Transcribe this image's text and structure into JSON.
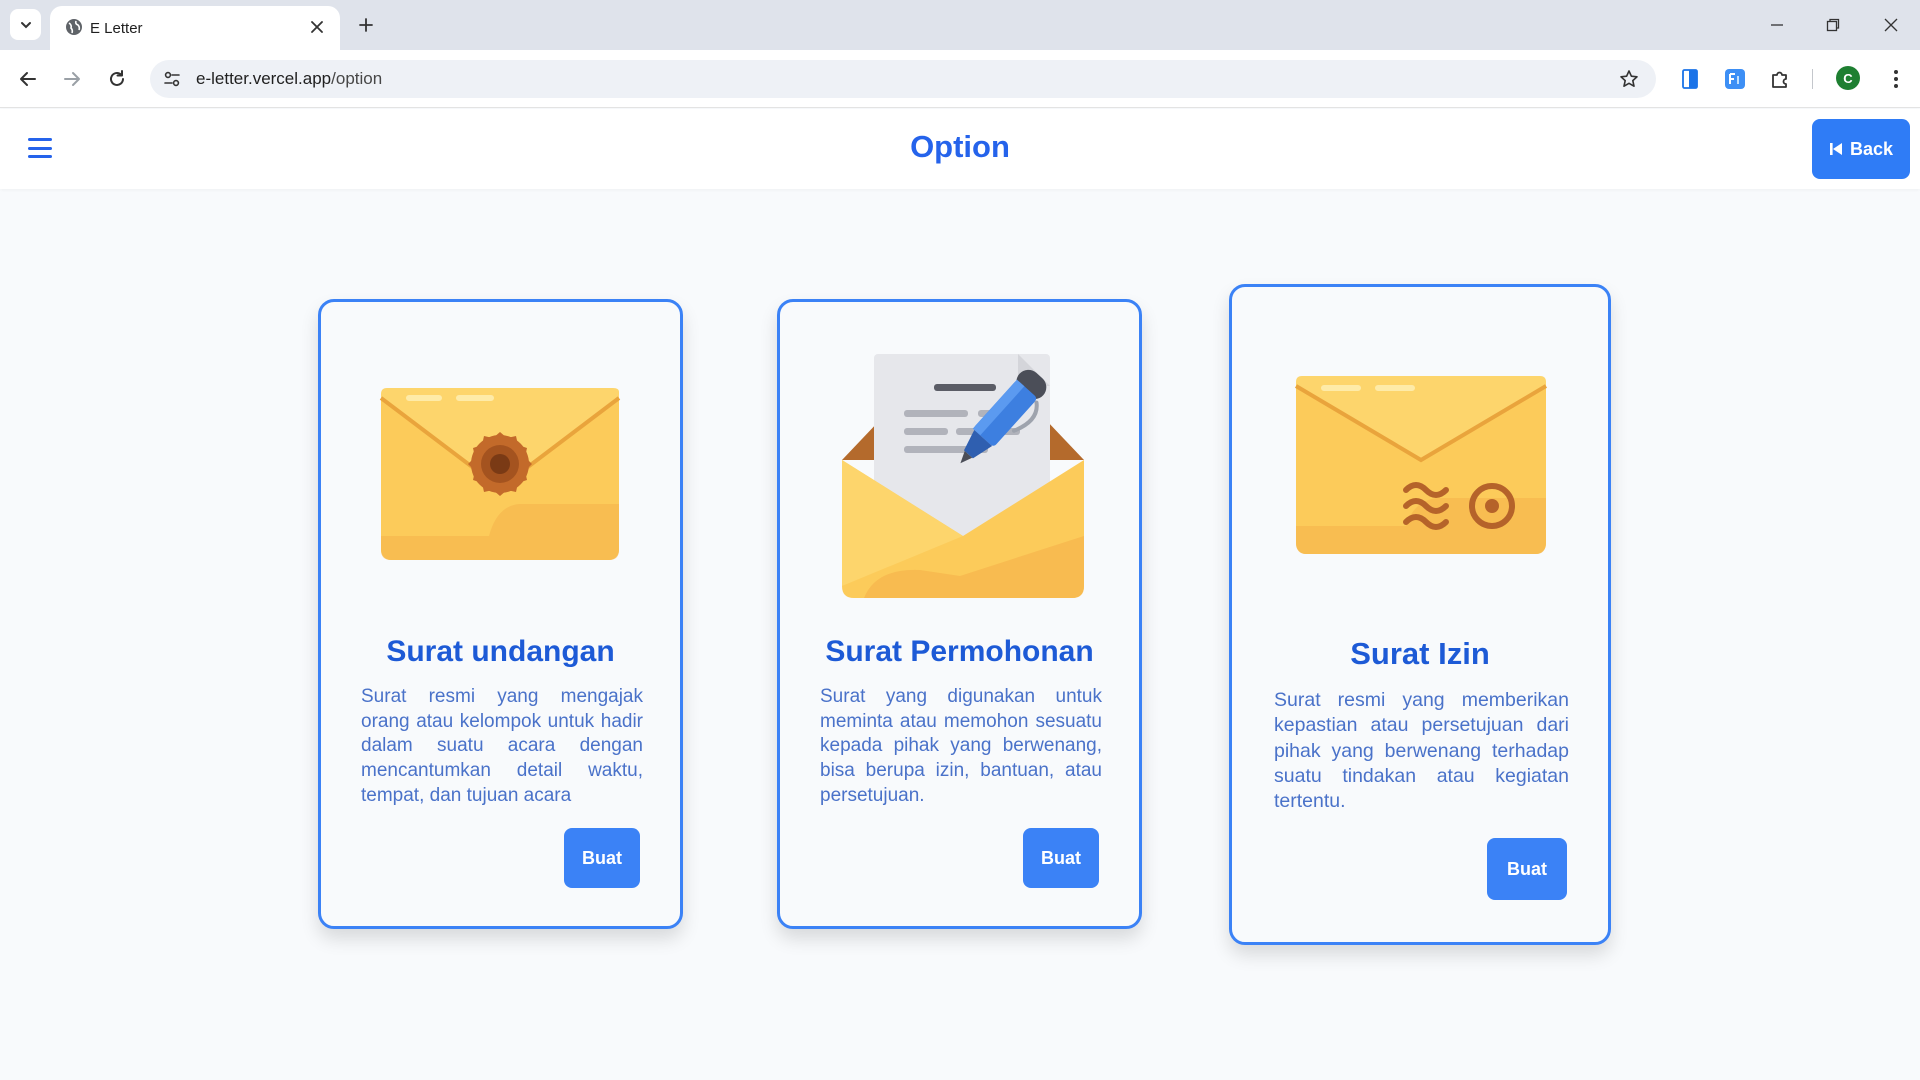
{
  "browser": {
    "tab_title": "E Letter",
    "url_host": "e-letter.vercel.app",
    "url_path": "/option",
    "profile_initial": "C"
  },
  "header": {
    "title": "Option",
    "back_label": "Back"
  },
  "cards": [
    {
      "title": "Surat undangan",
      "description": "Surat resmi yang mengajak orang atau kelompok untuk hadir dalam suatu acara dengan mencantumkan detail waktu, tempat, dan tujuan acara",
      "button_label": "Buat",
      "icon": "sealed-envelope-icon"
    },
    {
      "title": "Surat Permohonan",
      "description": "Surat yang digunakan untuk meminta atau memohon sesuatu kepada pihak yang berwenang, bisa berupa izin, bantuan, atau persetujuan.",
      "button_label": "Buat",
      "icon": "open-envelope-pen-icon"
    },
    {
      "title": "Surat Izin",
      "description": "Surat resmi yang memberikan kepastian atau persetujuan dari pihak yang berwenang terhadap suatu tindakan atau kegiatan tertentu.",
      "button_label": "Buat",
      "icon": "stamped-envelope-icon"
    }
  ],
  "colors": {
    "accent": "#2563eb",
    "button": "#3b82f6",
    "card_border": "#3b82f6",
    "envelope": "#fccb5a"
  }
}
